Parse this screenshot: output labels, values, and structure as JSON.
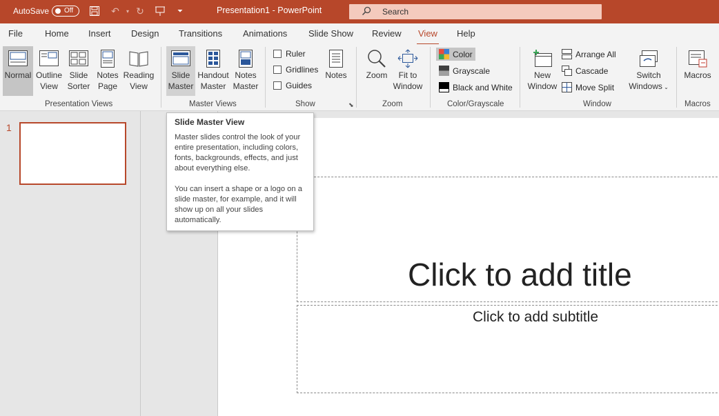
{
  "titlebar": {
    "autosave_label": "AutoSave",
    "autosave_state": "Off",
    "document_title": "Presentation1  -  PowerPoint",
    "search_placeholder": "Search",
    "color": "#b7472a"
  },
  "menu": {
    "tabs": [
      "File",
      "Home",
      "Insert",
      "Design",
      "Transitions",
      "Animations",
      "Slide Show",
      "Review",
      "View",
      "Help"
    ],
    "active_tab": "View"
  },
  "ribbon": {
    "presentation_views": {
      "label": "Presentation Views",
      "normal": "Normal",
      "outline": [
        "Outline",
        "View"
      ],
      "sorter": [
        "Slide",
        "Sorter"
      ],
      "notes_page": [
        "Notes",
        "Page"
      ],
      "reading": [
        "Reading",
        "View"
      ]
    },
    "master_views": {
      "label": "Master Views",
      "slide_master": [
        "Slide",
        "Master"
      ],
      "handout_master": [
        "Handout",
        "Master"
      ],
      "notes_master": [
        "Notes",
        "Master"
      ]
    },
    "show": {
      "label": "Show",
      "ruler": "Ruler",
      "gridlines": "Gridlines",
      "guides": "Guides",
      "notes": "Notes"
    },
    "zoom": {
      "label": "Zoom",
      "zoom": "Zoom",
      "fit": [
        "Fit to",
        "Window"
      ]
    },
    "color_grayscale": {
      "label": "Color/Grayscale",
      "color": "Color",
      "grayscale": "Grayscale",
      "bw": "Black and White"
    },
    "window": {
      "label": "Window",
      "new_window": [
        "New",
        "Window"
      ],
      "arrange_all": "Arrange All",
      "cascade": "Cascade",
      "move_split": "Move Split",
      "switch": [
        "Switch",
        "Windows"
      ]
    },
    "macros": {
      "label": "Macros",
      "macros": "Macros"
    }
  },
  "thumbnails": {
    "slide_number": "1"
  },
  "slide": {
    "title_placeholder": "Click to add title",
    "subtitle_placeholder": "Click to add subtitle"
  },
  "tooltip": {
    "title": "Slide Master View",
    "para1": "Master slides control the look of your entire presentation, including colors, fonts, backgrounds, effects, and just about everything else.",
    "para2": "You can insert a shape or a logo on a slide master, for example, and it will show up on all your slides automatically."
  }
}
